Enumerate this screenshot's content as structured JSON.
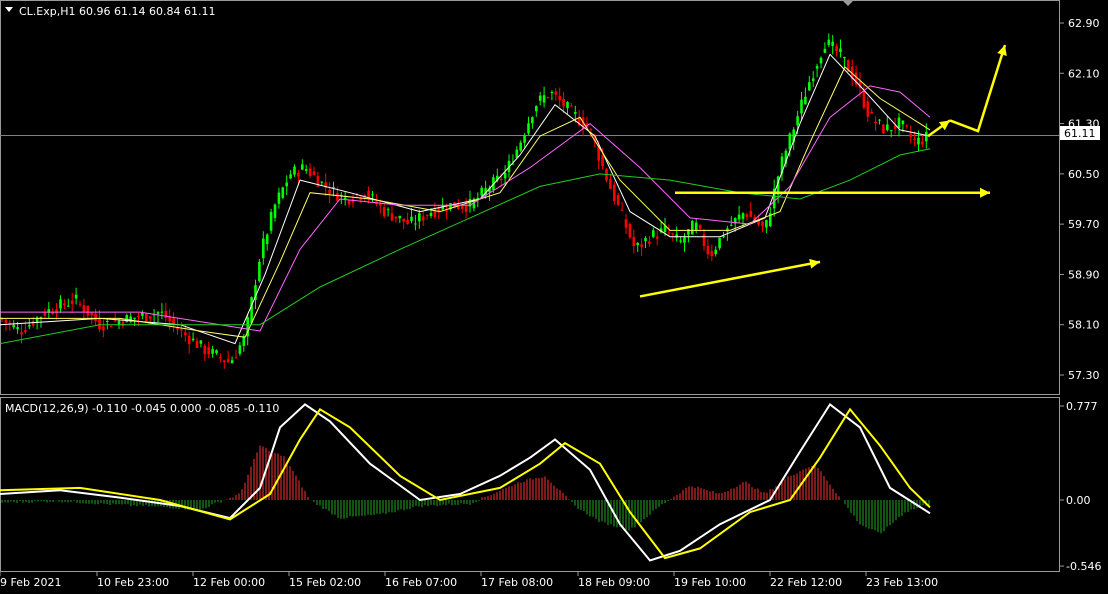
{
  "main_panel": {
    "header_text": "CL.Exp,H1  60.96 61.14 60.84 61.11",
    "current_price": "61.11",
    "colors": {
      "bull": "#00ff00",
      "bear": "#ff0000",
      "ma_fast": "#ffffff",
      "ma_mid": "#ffff66",
      "ma_slow": "#ff66ff",
      "ma_long": "#22cc22",
      "arrows": "#ffff00",
      "price_line": "#7080a8"
    }
  },
  "macd_panel": {
    "header_text": "MACD(12,26,9) -0.110 -0.045 0.000 -0.085 -0.110",
    "colors": {
      "macd_line": "#ffffff",
      "signal_line": "#ffff00",
      "hist_pos": "#ff3333",
      "hist_neg": "#22aa22"
    }
  },
  "chart_data": [
    {
      "type": "candlestick",
      "title": "CL.Exp,H1",
      "ohlc_shown": {
        "open": 60.96,
        "high": 61.14,
        "low": 60.84,
        "close": 61.11
      },
      "y_ticks": [
        "62.90",
        "62.10",
        "61.30",
        "60.50",
        "59.70",
        "58.90",
        "58.10",
        "57.30"
      ],
      "ylim": [
        57.0,
        63.2
      ],
      "x_ticks": [
        "9 Feb 2021",
        "10 Feb 23:00",
        "12 Feb 00:00",
        "15 Feb 02:00",
        "16 Feb 07:00",
        "17 Feb 08:00",
        "18 Feb 09:00",
        "19 Feb 10:00",
        "22 Feb 12:00",
        "23 Feb 13:00"
      ],
      "last_price": 61.11,
      "price_path": [
        {
          "x": 0,
          "p": 58.2
        },
        {
          "x": 20,
          "p": 58.0
        },
        {
          "x": 45,
          "p": 58.3
        },
        {
          "x": 75,
          "p": 58.5
        },
        {
          "x": 100,
          "p": 58.1
        },
        {
          "x": 130,
          "p": 58.2
        },
        {
          "x": 160,
          "p": 58.3
        },
        {
          "x": 180,
          "p": 58.0
        },
        {
          "x": 205,
          "p": 57.7
        },
        {
          "x": 230,
          "p": 57.5
        },
        {
          "x": 245,
          "p": 57.9
        },
        {
          "x": 260,
          "p": 59.2
        },
        {
          "x": 275,
          "p": 60.0
        },
        {
          "x": 290,
          "p": 60.5
        },
        {
          "x": 305,
          "p": 60.6
        },
        {
          "x": 325,
          "p": 60.3
        },
        {
          "x": 345,
          "p": 60.1
        },
        {
          "x": 365,
          "p": 60.2
        },
        {
          "x": 385,
          "p": 59.9
        },
        {
          "x": 410,
          "p": 59.7
        },
        {
          "x": 430,
          "p": 59.9
        },
        {
          "x": 450,
          "p": 60.0
        },
        {
          "x": 470,
          "p": 60.0
        },
        {
          "x": 490,
          "p": 60.3
        },
        {
          "x": 505,
          "p": 60.5
        },
        {
          "x": 520,
          "p": 61.0
        },
        {
          "x": 535,
          "p": 61.6
        },
        {
          "x": 550,
          "p": 61.8
        },
        {
          "x": 570,
          "p": 61.5
        },
        {
          "x": 590,
          "p": 61.2
        },
        {
          "x": 605,
          "p": 60.5
        },
        {
          "x": 620,
          "p": 59.9
        },
        {
          "x": 635,
          "p": 59.3
        },
        {
          "x": 650,
          "p": 59.5
        },
        {
          "x": 665,
          "p": 59.6
        },
        {
          "x": 680,
          "p": 59.4
        },
        {
          "x": 695,
          "p": 59.7
        },
        {
          "x": 710,
          "p": 59.2
        },
        {
          "x": 725,
          "p": 59.6
        },
        {
          "x": 745,
          "p": 59.9
        },
        {
          "x": 765,
          "p": 59.6
        },
        {
          "x": 780,
          "p": 60.6
        },
        {
          "x": 795,
          "p": 61.3
        },
        {
          "x": 810,
          "p": 62.0
        },
        {
          "x": 825,
          "p": 62.6
        },
        {
          "x": 840,
          "p": 62.4
        },
        {
          "x": 855,
          "p": 62.0
        },
        {
          "x": 870,
          "p": 61.4
        },
        {
          "x": 885,
          "p": 61.2
        },
        {
          "x": 900,
          "p": 61.3
        },
        {
          "x": 915,
          "p": 61.0
        },
        {
          "x": 930,
          "p": 61.1
        }
      ],
      "moving_averages": [
        {
          "name": "fast",
          "values": [
            {
              "x": 0,
              "p": 58.1
            },
            {
              "x": 100,
              "p": 58.2
            },
            {
              "x": 180,
              "p": 58.1
            },
            {
              "x": 235,
              "p": 57.8
            },
            {
              "x": 265,
              "p": 58.9
            },
            {
              "x": 300,
              "p": 60.4
            },
            {
              "x": 350,
              "p": 60.2
            },
            {
              "x": 420,
              "p": 59.9
            },
            {
              "x": 480,
              "p": 60.1
            },
            {
              "x": 520,
              "p": 60.8
            },
            {
              "x": 555,
              "p": 61.6
            },
            {
              "x": 595,
              "p": 61.1
            },
            {
              "x": 630,
              "p": 59.9
            },
            {
              "x": 670,
              "p": 59.5
            },
            {
              "x": 720,
              "p": 59.5
            },
            {
              "x": 765,
              "p": 59.8
            },
            {
              "x": 800,
              "p": 61.3
            },
            {
              "x": 830,
              "p": 62.4
            },
            {
              "x": 860,
              "p": 61.9
            },
            {
              "x": 900,
              "p": 61.2
            },
            {
              "x": 930,
              "p": 61.1
            }
          ]
        },
        {
          "name": "mid",
          "values": [
            {
              "x": 0,
              "p": 58.2
            },
            {
              "x": 120,
              "p": 58.2
            },
            {
              "x": 200,
              "p": 58.0
            },
            {
              "x": 245,
              "p": 57.9
            },
            {
              "x": 280,
              "p": 59.1
            },
            {
              "x": 310,
              "p": 60.2
            },
            {
              "x": 370,
              "p": 60.1
            },
            {
              "x": 440,
              "p": 59.9
            },
            {
              "x": 500,
              "p": 60.2
            },
            {
              "x": 540,
              "p": 61.1
            },
            {
              "x": 580,
              "p": 61.4
            },
            {
              "x": 620,
              "p": 60.4
            },
            {
              "x": 670,
              "p": 59.6
            },
            {
              "x": 730,
              "p": 59.6
            },
            {
              "x": 780,
              "p": 59.9
            },
            {
              "x": 810,
              "p": 61.0
            },
            {
              "x": 845,
              "p": 62.2
            },
            {
              "x": 880,
              "p": 61.7
            },
            {
              "x": 930,
              "p": 61.2
            }
          ]
        },
        {
          "name": "slow",
          "values": [
            {
              "x": 0,
              "p": 58.3
            },
            {
              "x": 140,
              "p": 58.3
            },
            {
              "x": 220,
              "p": 58.1
            },
            {
              "x": 260,
              "p": 58.0
            },
            {
              "x": 300,
              "p": 59.3
            },
            {
              "x": 340,
              "p": 60.1
            },
            {
              "x": 400,
              "p": 60.0
            },
            {
              "x": 470,
              "p": 60.0
            },
            {
              "x": 530,
              "p": 60.6
            },
            {
              "x": 590,
              "p": 61.3
            },
            {
              "x": 640,
              "p": 60.6
            },
            {
              "x": 690,
              "p": 59.8
            },
            {
              "x": 750,
              "p": 59.7
            },
            {
              "x": 790,
              "p": 60.3
            },
            {
              "x": 830,
              "p": 61.4
            },
            {
              "x": 870,
              "p": 61.9
            },
            {
              "x": 900,
              "p": 61.8
            },
            {
              "x": 930,
              "p": 61.4
            }
          ]
        },
        {
          "name": "long",
          "values": [
            {
              "x": 0,
              "p": 57.8
            },
            {
              "x": 100,
              "p": 58.1
            },
            {
              "x": 200,
              "p": 58.1
            },
            {
              "x": 260,
              "p": 58.1
            },
            {
              "x": 320,
              "p": 58.7
            },
            {
              "x": 400,
              "p": 59.3
            },
            {
              "x": 470,
              "p": 59.8
            },
            {
              "x": 540,
              "p": 60.3
            },
            {
              "x": 600,
              "p": 60.5
            },
            {
              "x": 670,
              "p": 60.4
            },
            {
              "x": 740,
              "p": 60.2
            },
            {
              "x": 800,
              "p": 60.1
            },
            {
              "x": 850,
              "p": 60.4
            },
            {
              "x": 900,
              "p": 60.8
            },
            {
              "x": 930,
              "p": 60.9
            }
          ]
        }
      ],
      "annotations": [
        {
          "type": "arrow",
          "from": {
            "x": 640,
            "p": 58.55
          },
          "to": {
            "x": 820,
            "p": 59.1
          }
        },
        {
          "type": "arrow",
          "from": {
            "x": 675,
            "p": 60.2
          },
          "to": {
            "x": 990,
            "p": 60.2
          }
        },
        {
          "type": "polyline",
          "points": [
            {
              "x": 928,
              "p": 61.1
            },
            {
              "x": 950,
              "p": 61.35
            }
          ]
        },
        {
          "type": "polyline",
          "points": [
            {
              "x": 950,
              "p": 61.35
            },
            {
              "x": 978,
              "p": 61.18
            },
            {
              "x": 1005,
              "p": 62.55
            }
          ]
        }
      ]
    },
    {
      "type": "line",
      "title": "MACD(12,26,9)",
      "y_ticks": [
        "0.777",
        "0.00",
        "-0.546"
      ],
      "ylim": [
        -0.6,
        0.85
      ],
      "series": [
        {
          "role": "macd",
          "values": [
            {
              "x": 0,
              "p": 0.05
            },
            {
              "x": 60,
              "p": 0.08
            },
            {
              "x": 120,
              "p": 0.02
            },
            {
              "x": 180,
              "p": -0.05
            },
            {
              "x": 230,
              "p": -0.15
            },
            {
              "x": 260,
              "p": 0.1
            },
            {
              "x": 280,
              "p": 0.6
            },
            {
              "x": 305,
              "p": 0.79
            },
            {
              "x": 330,
              "p": 0.65
            },
            {
              "x": 370,
              "p": 0.3
            },
            {
              "x": 420,
              "p": 0.0
            },
            {
              "x": 460,
              "p": 0.05
            },
            {
              "x": 500,
              "p": 0.2
            },
            {
              "x": 530,
              "p": 0.35
            },
            {
              "x": 555,
              "p": 0.5
            },
            {
              "x": 590,
              "p": 0.25
            },
            {
              "x": 620,
              "p": -0.2
            },
            {
              "x": 650,
              "p": -0.5
            },
            {
              "x": 680,
              "p": -0.42
            },
            {
              "x": 720,
              "p": -0.2
            },
            {
              "x": 770,
              "p": 0.0
            },
            {
              "x": 800,
              "p": 0.4
            },
            {
              "x": 830,
              "p": 0.79
            },
            {
              "x": 860,
              "p": 0.6
            },
            {
              "x": 890,
              "p": 0.1
            },
            {
              "x": 930,
              "p": -0.11
            }
          ]
        },
        {
          "role": "signal",
          "values": [
            {
              "x": 0,
              "p": 0.08
            },
            {
              "x": 80,
              "p": 0.1
            },
            {
              "x": 160,
              "p": 0.0
            },
            {
              "x": 230,
              "p": -0.16
            },
            {
              "x": 270,
              "p": 0.05
            },
            {
              "x": 300,
              "p": 0.5
            },
            {
              "x": 320,
              "p": 0.75
            },
            {
              "x": 350,
              "p": 0.6
            },
            {
              "x": 400,
              "p": 0.2
            },
            {
              "x": 440,
              "p": 0.0
            },
            {
              "x": 500,
              "p": 0.1
            },
            {
              "x": 540,
              "p": 0.3
            },
            {
              "x": 565,
              "p": 0.47
            },
            {
              "x": 600,
              "p": 0.3
            },
            {
              "x": 630,
              "p": -0.1
            },
            {
              "x": 665,
              "p": -0.48
            },
            {
              "x": 700,
              "p": -0.4
            },
            {
              "x": 750,
              "p": -0.1
            },
            {
              "x": 790,
              "p": 0.0
            },
            {
              "x": 820,
              "p": 0.35
            },
            {
              "x": 850,
              "p": 0.75
            },
            {
              "x": 880,
              "p": 0.45
            },
            {
              "x": 910,
              "p": 0.1
            },
            {
              "x": 930,
              "p": -0.06
            }
          ]
        }
      ],
      "histogram_samples": [
        {
          "x": 0,
          "p": -0.02
        },
        {
          "x": 60,
          "p": -0.01
        },
        {
          "x": 120,
          "p": -0.04
        },
        {
          "x": 170,
          "p": -0.06
        },
        {
          "x": 200,
          "p": -0.08
        },
        {
          "x": 240,
          "p": 0.05
        },
        {
          "x": 260,
          "p": 0.45
        },
        {
          "x": 285,
          "p": 0.35
        },
        {
          "x": 310,
          "p": 0.0
        },
        {
          "x": 340,
          "p": -0.15
        },
        {
          "x": 380,
          "p": -0.12
        },
        {
          "x": 420,
          "p": -0.05
        },
        {
          "x": 470,
          "p": -0.03
        },
        {
          "x": 520,
          "p": 0.15
        },
        {
          "x": 545,
          "p": 0.2
        },
        {
          "x": 575,
          "p": -0.05
        },
        {
          "x": 600,
          "p": -0.18
        },
        {
          "x": 630,
          "p": -0.25
        },
        {
          "x": 660,
          "p": -0.05
        },
        {
          "x": 690,
          "p": 0.12
        },
        {
          "x": 720,
          "p": 0.05
        },
        {
          "x": 745,
          "p": 0.15
        },
        {
          "x": 765,
          "p": 0.05
        },
        {
          "x": 790,
          "p": 0.2
        },
        {
          "x": 815,
          "p": 0.3
        },
        {
          "x": 840,
          "p": 0.02
        },
        {
          "x": 860,
          "p": -0.2
        },
        {
          "x": 880,
          "p": -0.28
        },
        {
          "x": 905,
          "p": -0.1
        },
        {
          "x": 930,
          "p": -0.03
        }
      ]
    }
  ]
}
